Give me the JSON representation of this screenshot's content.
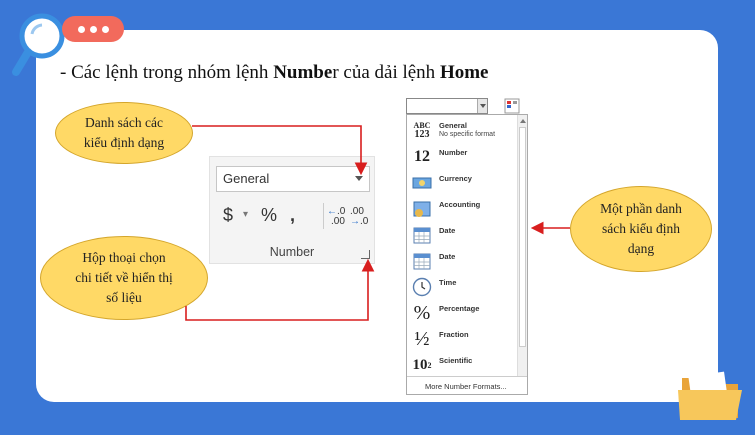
{
  "heading": {
    "prefix": "- Các lệnh trong nhóm lệnh ",
    "bold1": "Numbe",
    "mid": "r của dải lệnh ",
    "bold2": "Home"
  },
  "callouts": {
    "format_list": [
      "Danh sách các",
      "kiểu định dạng"
    ],
    "dialog": [
      "Hộp thoại chọn",
      "chi tiết về hiển thị",
      "số liệu"
    ],
    "partial_list": [
      "Một phần danh",
      "sách kiểu định",
      "dạng"
    ]
  },
  "ribbon": {
    "selected_format": "General",
    "currency_symbol": "$",
    "percent_symbol": "%",
    "comma_symbol": ",",
    "increase_decimal": [
      ".0",
      ".00"
    ],
    "decrease_decimal": [
      ".00",
      ".0"
    ],
    "group_label": "Number"
  },
  "dropdown": {
    "items": [
      {
        "label": "General",
        "sub": "No specific format",
        "icon": "ABC-123"
      },
      {
        "label": "Number",
        "icon": "12"
      },
      {
        "label": "Currency",
        "icon": "currency-icon"
      },
      {
        "label": "Accounting",
        "icon": "accounting-icon"
      },
      {
        "label": "Date",
        "icon": "calendar-icon"
      },
      {
        "label": "Date",
        "icon": "calendar-icon"
      },
      {
        "label": "Time",
        "icon": "clock-icon"
      },
      {
        "label": "Percentage",
        "icon": "%"
      },
      {
        "label": "Fraction",
        "icon": "½"
      },
      {
        "label": "Scientific",
        "icon": "10²"
      }
    ],
    "more": "More Number Formats..."
  },
  "icon_text": {
    "abc": "ABC",
    "num123": "123",
    "twelve": "12",
    "percent": "%",
    "half": "½",
    "ten": "10",
    "sq": "2"
  },
  "colors": {
    "background": "#3a77d6",
    "callout_fill": "#ffd966",
    "arrow": "#d81e1e",
    "pill": "#f26a5c"
  }
}
